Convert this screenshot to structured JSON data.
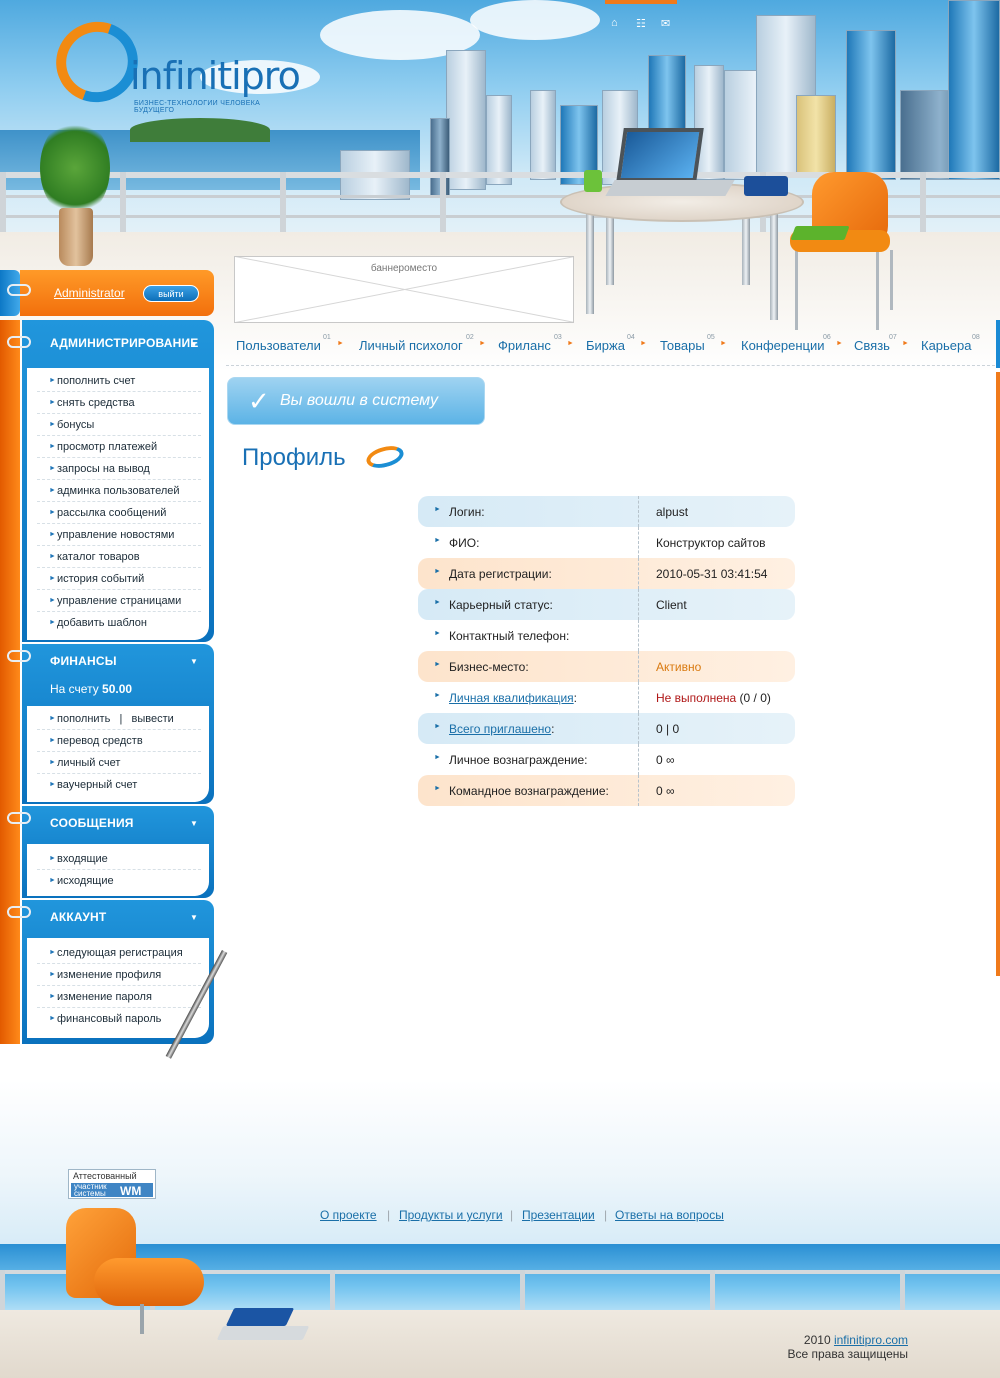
{
  "header": {
    "logo_text": "infinitipro",
    "logo_tagline": "БИЗНЕС-ТЕХНОЛОГИИ ЧЕЛОВЕКА БУДУЩЕГО",
    "top_icons": [
      "home-icon",
      "sitemap-icon",
      "mail-icon"
    ]
  },
  "user": {
    "name": "Administrator",
    "logout_label": "выйти"
  },
  "banner": {
    "label": "баннероместо"
  },
  "nav": {
    "items": [
      {
        "label": "Пользователи",
        "num": "01"
      },
      {
        "label": "Личный психолог",
        "num": "02"
      },
      {
        "label": "Фриланс",
        "num": "03"
      },
      {
        "label": "Биржа",
        "num": "04"
      },
      {
        "label": "Товары",
        "num": "05"
      },
      {
        "label": "Конференции",
        "num": "06"
      },
      {
        "label": "Связь",
        "num": "07"
      },
      {
        "label": "Карьера",
        "num": "08"
      }
    ]
  },
  "sidebar": {
    "admin": {
      "title": "АДМИНИСТРИРОВАНИЕ",
      "items": [
        "пополнить счет",
        "снять средства",
        "бонусы",
        "просмотр платежей",
        "запросы на вывод",
        "админка пользователей",
        "рассылка сообщений",
        "управление новостями",
        "каталог товаров",
        "история событий",
        "управление страницами",
        "добавить шаблон"
      ]
    },
    "finance": {
      "title": "ФИНАНСЫ",
      "balance_label": "На счету",
      "balance_value": "50.00",
      "topup": "пополнить",
      "sep": "|",
      "withdraw": "вывести",
      "items": [
        "перевод средств",
        "личный счет",
        "ваучерный счет"
      ]
    },
    "messages": {
      "title": "СООБЩЕНИЯ",
      "items": [
        "входящие",
        "исходящие"
      ]
    },
    "account": {
      "title": "АККАУНТ",
      "items": [
        "следующая регистрация",
        "изменение профиля",
        "изменение пароля",
        "финансовый пароль"
      ]
    }
  },
  "main": {
    "login_message": "Вы вошли в систему",
    "page_title": "Профиль",
    "profile": [
      {
        "label": "Логин:",
        "value": "alpust"
      },
      {
        "label": "ФИО:",
        "value": "Конструктор сайтов"
      },
      {
        "label": "Дата регистрации:",
        "value": "2010-05-31 03:41:54"
      },
      {
        "label": "Карьерный статус:",
        "value": "Client"
      },
      {
        "label": "Контактный телефон:",
        "value": ""
      },
      {
        "label": "Бизнес-место:",
        "value": "Активно"
      },
      {
        "label": "Личная квалификация",
        "label_suffix": ":",
        "value": "Не выполнена",
        "value_suffix": " (0 / 0)"
      },
      {
        "label": "Всего приглашено",
        "label_suffix": ":",
        "value": "0 | 0"
      },
      {
        "label": "Личное вознаграждение:",
        "value": "0 ∞"
      },
      {
        "label": "Командное вознаграждение:",
        "value": "0 ∞"
      }
    ]
  },
  "footer": {
    "badge_line1": "Аттестованный",
    "badge_line2a": "участник",
    "badge_line2b": "системы",
    "badge_wm": "WM",
    "links": [
      "О проекте",
      "Продукты и услуги",
      "Презентации",
      "Ответы на вопросы"
    ],
    "link_sep": "|",
    "year": "2010",
    "site": "infinitipro.com",
    "rights": "Все права защищены"
  }
}
